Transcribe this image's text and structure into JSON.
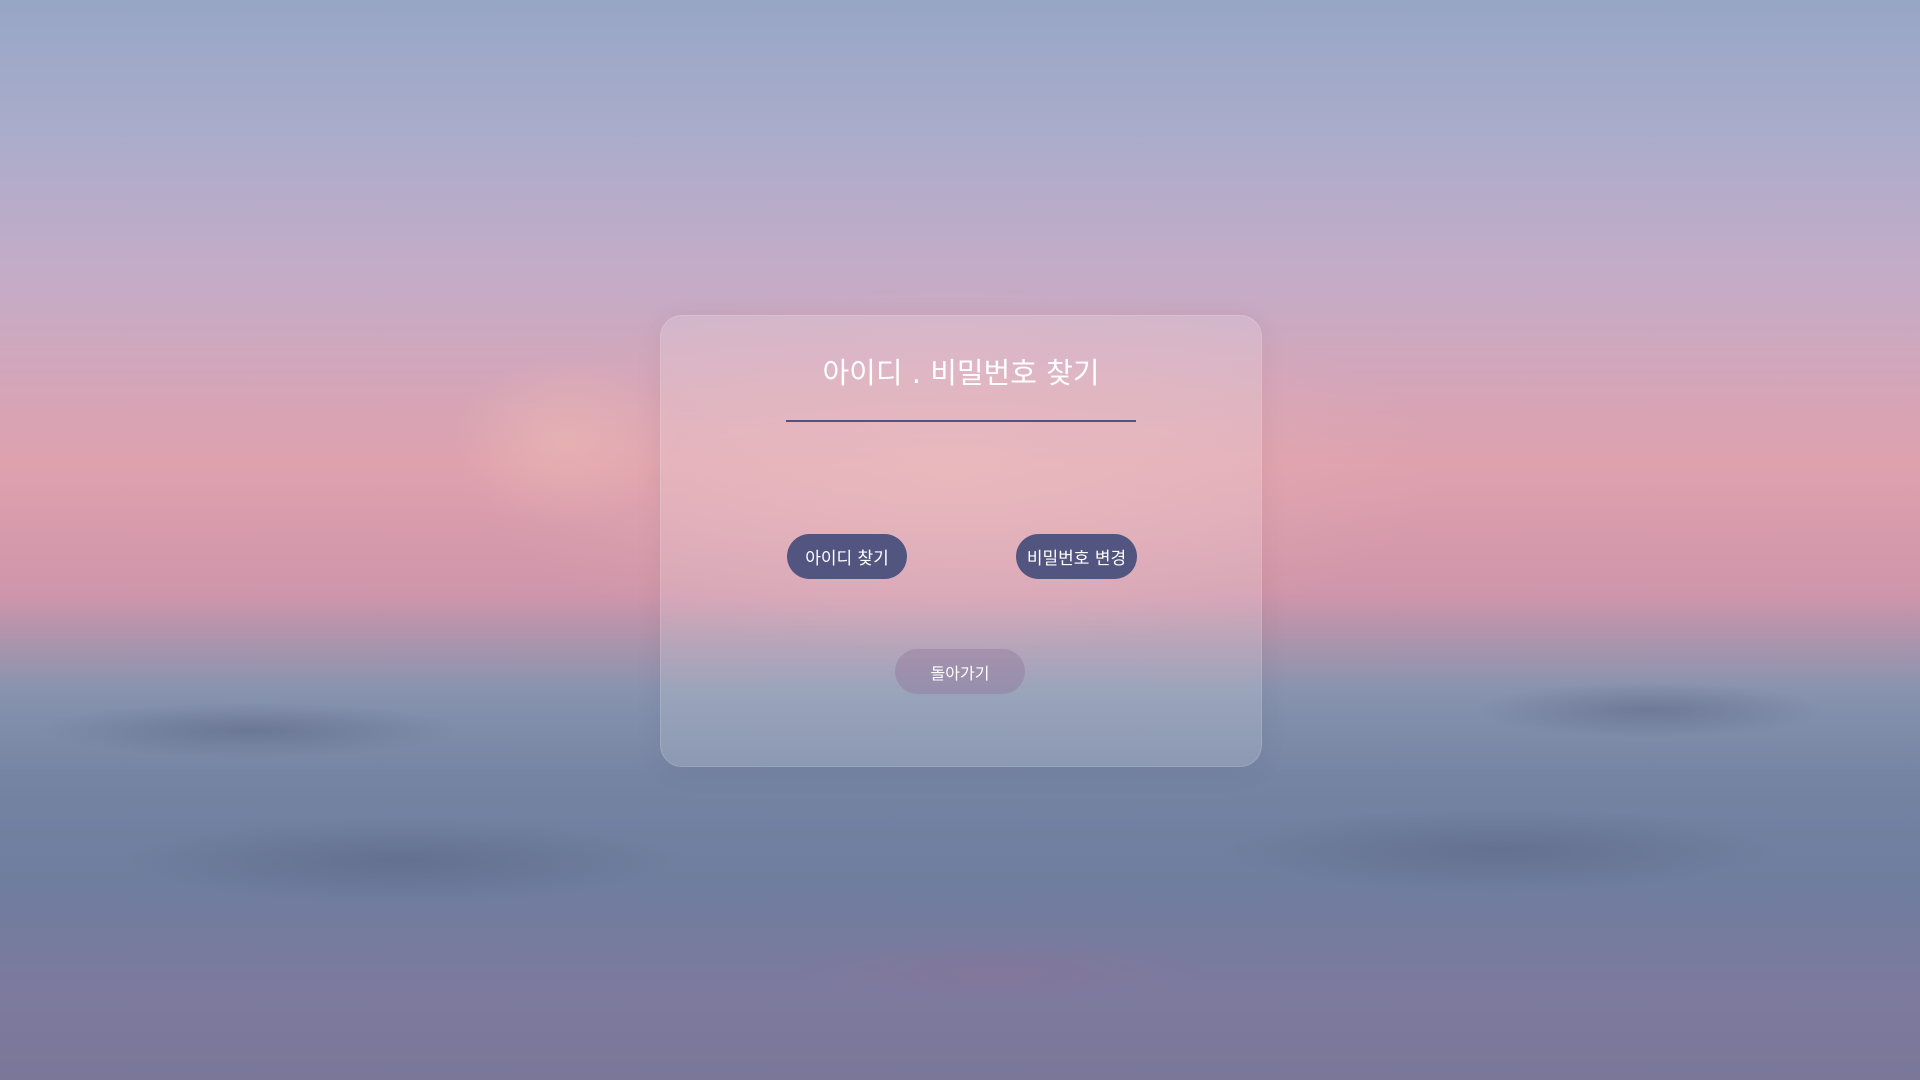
{
  "card": {
    "title": "아이디 . 비밀번호 찾기",
    "find_id_label": "아이디 찾기",
    "change_password_label": "비밀번호 변경",
    "back_label": "돌아가기"
  },
  "colors": {
    "accent": "#52557f"
  }
}
